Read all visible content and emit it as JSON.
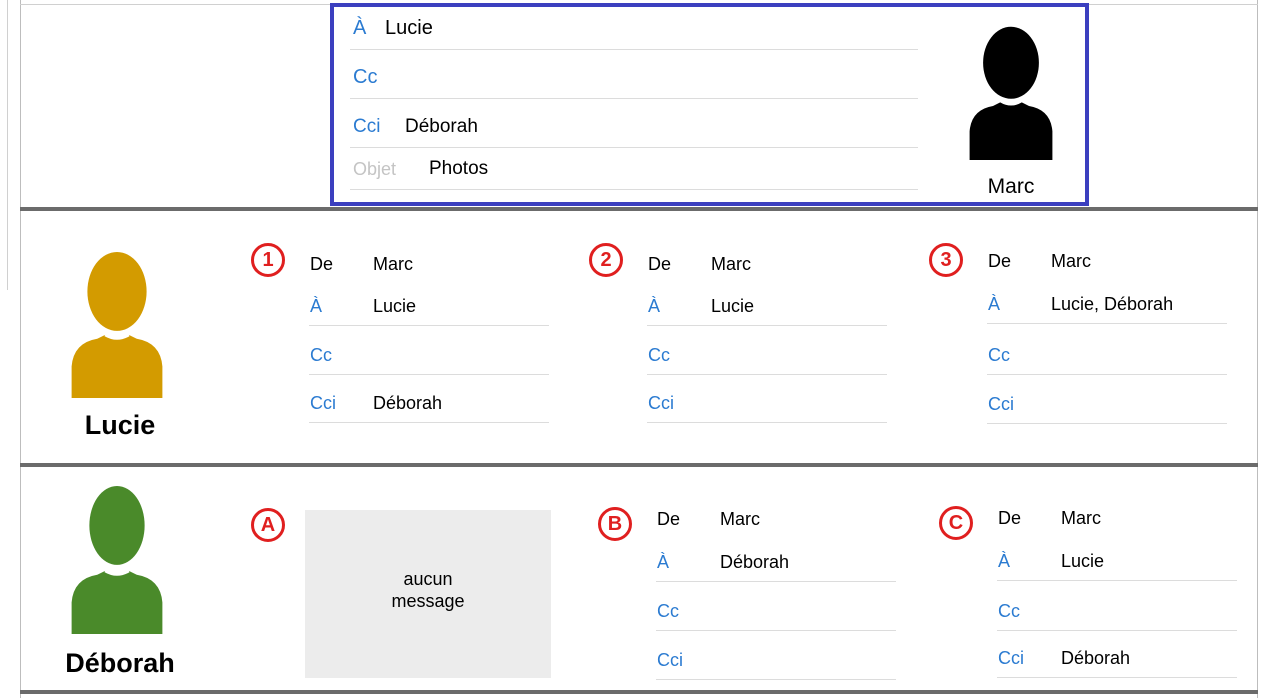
{
  "compose": {
    "to_label": "À",
    "to_value": "Lucie",
    "cc_label": "Cc",
    "cc_value": "",
    "bcc_label": "Cci",
    "bcc_value": "Déborah",
    "subject_label": "Objet",
    "subject_value": "Photos",
    "sender_name": "Marc",
    "sender_color": "#000000"
  },
  "lucie": {
    "name": "Lucie",
    "color": "#d39b00",
    "mails": [
      {
        "badge": "1",
        "from_label": "De",
        "from": "Marc",
        "to_label": "À",
        "to": "Lucie",
        "cc_label": "Cc",
        "cc": "",
        "bcc_label": "Cci",
        "bcc": "Déborah"
      },
      {
        "badge": "2",
        "from_label": "De",
        "from": "Marc",
        "to_label": "À",
        "to": "Lucie",
        "cc_label": "Cc",
        "cc": "",
        "bcc_label": "Cci",
        "bcc": ""
      },
      {
        "badge": "3",
        "from_label": "De",
        "from": "Marc",
        "to_label": "À",
        "to": "Lucie, Déborah",
        "cc_label": "Cc",
        "cc": "",
        "bcc_label": "Cci",
        "bcc": ""
      }
    ]
  },
  "deborah": {
    "name": "Déborah",
    "color": "#4a8a2a",
    "empty_badge": "A",
    "empty_message_line1": "aucun",
    "empty_message_line2": "message",
    "mails": [
      {
        "badge": "B",
        "from_label": "De",
        "from": "Marc",
        "to_label": "À",
        "to": "Déborah",
        "cc_label": "Cc",
        "cc": "",
        "bcc_label": "Cci",
        "bcc": ""
      },
      {
        "badge": "C",
        "from_label": "De",
        "from": "Marc",
        "to_label": "À",
        "to": "Lucie",
        "cc_label": "Cc",
        "cc": "",
        "bcc_label": "Cci",
        "bcc": "Déborah"
      }
    ]
  }
}
